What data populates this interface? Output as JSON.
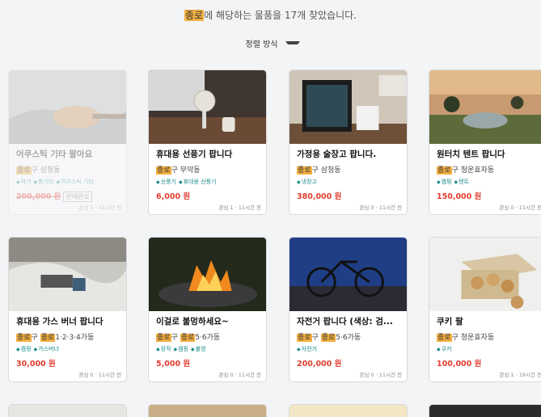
{
  "search": {
    "keyword": "종로",
    "summary_suffix": "에 해당하는 물품을 17개 찾았습니다.",
    "sort_label": "정렬 방식"
  },
  "items": [
    {
      "title": "어쿠스틱 기타 팔아요",
      "loc_hl": "종로",
      "loc_rest": "구 삼청동",
      "tags": [
        "악기",
        "통기타",
        "어쿠스틱 기타"
      ],
      "price": "200,000 원",
      "badge": "판매완료",
      "meta": "관심 0 · 11시간 전",
      "sold": true
    },
    {
      "title": "휴대용 선풍기 팝니다",
      "loc_hl": "종로",
      "loc_rest": "구 무악동",
      "tags": [
        "선풍기",
        "휴대용 선풍기"
      ],
      "price": "6,000 원",
      "badge": "",
      "meta": "관심 1 · 11시간 전",
      "sold": false
    },
    {
      "title": "가정용 술장고 팝니다.",
      "loc_hl": "종로",
      "loc_rest": "구 삼청동",
      "tags": [
        "냉장고"
      ],
      "price": "380,000 원",
      "badge": "",
      "meta": "관심 0 · 11시간 전",
      "sold": false
    },
    {
      "title": "원터치 텐트 팝니다",
      "loc_hl": "종로",
      "loc_rest": "구 청운효자동",
      "tags": [
        "캠핑",
        "텐트"
      ],
      "price": "150,000 원",
      "badge": "",
      "meta": "관심 0 · 11시간 전",
      "sold": false
    },
    {
      "title": "휴대용 가스 버너 팝니다",
      "loc_hl": "종로",
      "loc_mid": "구 ",
      "loc_hl2": "종로",
      "loc_rest": "1·2·3·4가동",
      "tags": [
        "캠핑",
        "가스버너"
      ],
      "price": "30,000 원",
      "badge": "",
      "meta": "관심 0 · 11시간 전",
      "sold": false
    },
    {
      "title": "이걸로 불멍하세요~",
      "loc_hl": "종로",
      "loc_mid": "구 ",
      "loc_hl2": "종로",
      "loc_rest": "5·6가동",
      "tags": [
        "장작",
        "캠핑",
        "불멍"
      ],
      "price": "5,000 원",
      "badge": "",
      "meta": "관심 0 · 11시간 전",
      "sold": false
    },
    {
      "title": "자전거 팝니다 (색상: 검...",
      "loc_hl": "종로",
      "loc_mid": "구 ",
      "loc_hl2": "종로",
      "loc_rest": "5·6가동",
      "tags": [
        "자전거"
      ],
      "price": "200,000 원",
      "badge": "",
      "meta": "관심 0 · 11시간 전",
      "sold": false
    },
    {
      "title": "쿠키 팔",
      "loc_hl": "종로",
      "loc_rest": "구 청운효자동",
      "tags": [
        "쿠키"
      ],
      "price": "100,000 원",
      "badge": "",
      "meta": "관심 1 · 19시간 전",
      "sold": false
    }
  ],
  "colors": {
    "highlight": "#f5b041",
    "price": "#e23d2e",
    "tag": "#1a8a8a"
  },
  "icons": {
    "sort_caret": "caret-down-icon",
    "tag": "tag-icon"
  }
}
